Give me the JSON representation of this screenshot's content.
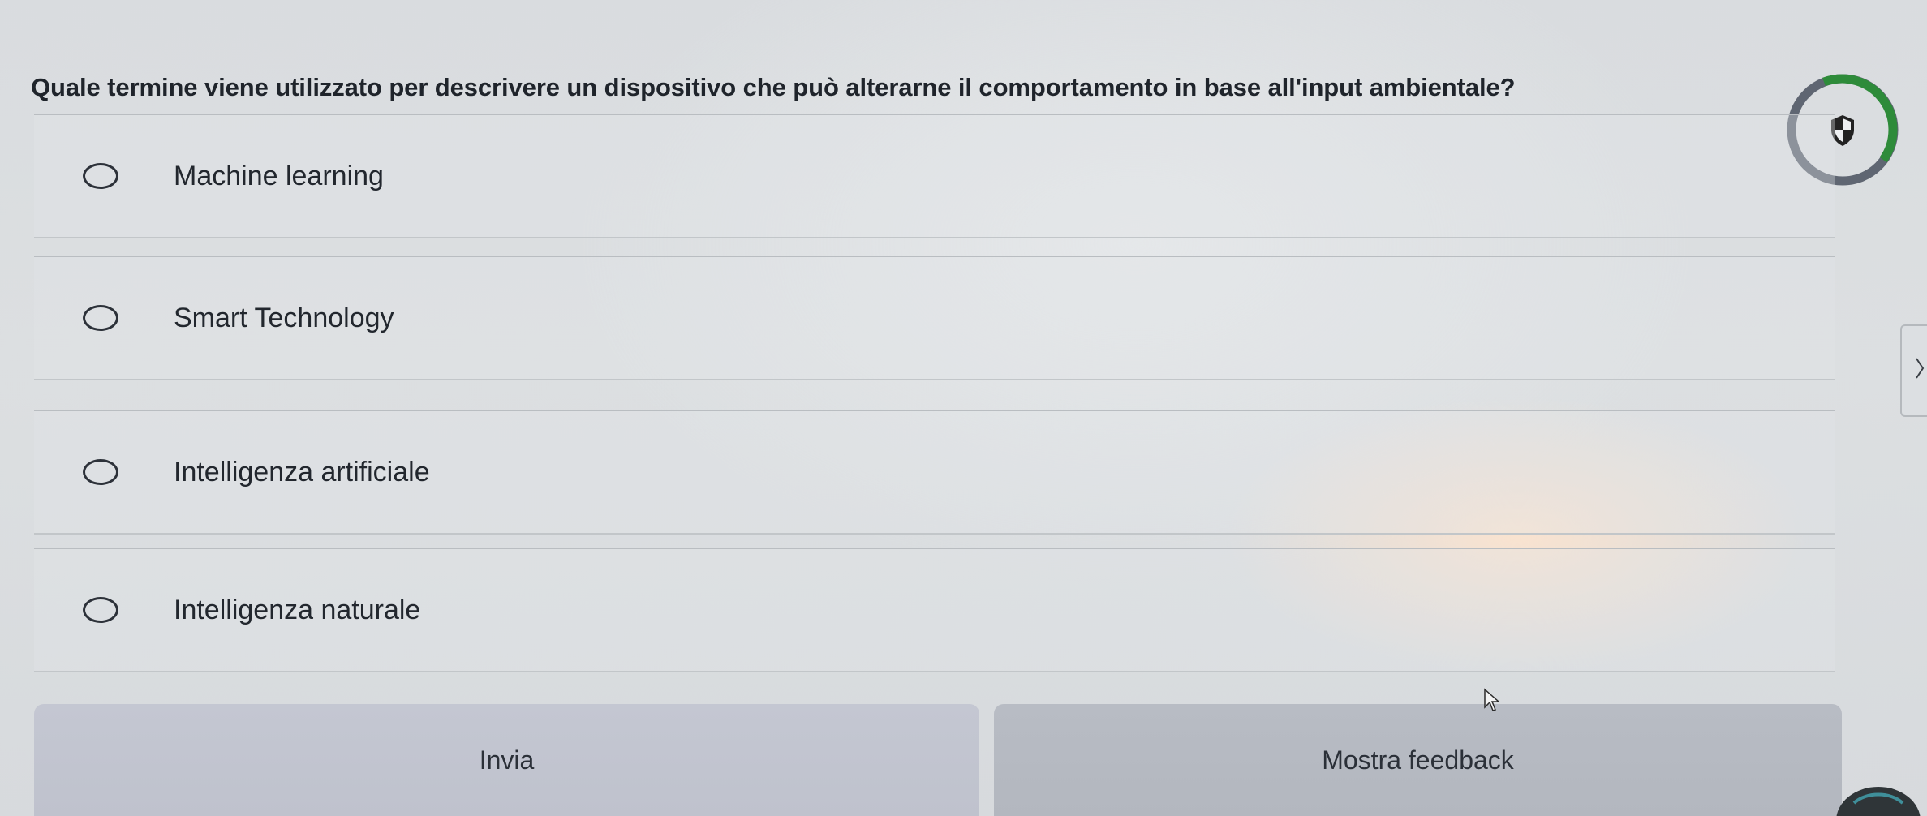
{
  "question": {
    "text": "Quale termine viene utilizzato per descrivere un dispositivo che può alterarne il comportamento in base all'input ambientale?"
  },
  "options": [
    {
      "label": "Machine learning",
      "selected": false
    },
    {
      "label": "Smart Technology",
      "selected": false
    },
    {
      "label": "Intelligenza artificiale",
      "selected": false
    },
    {
      "label": "Intelligenza naturale",
      "selected": false
    }
  ],
  "buttons": {
    "submit_label": "Invia",
    "feedback_label": "Mostra feedback"
  },
  "timer": {
    "icon": "shield-icon",
    "colors": {
      "ring_track": "#5f6672",
      "ring_progress": "#2e8b3a",
      "icon": "#222222"
    }
  },
  "side_tab": {
    "icon": "chevron-right-icon"
  },
  "colors": {
    "background": "#dadddf",
    "submit_button": "#c3c6d1",
    "feedback_button": "#b6bac2",
    "text": "#22272e"
  }
}
